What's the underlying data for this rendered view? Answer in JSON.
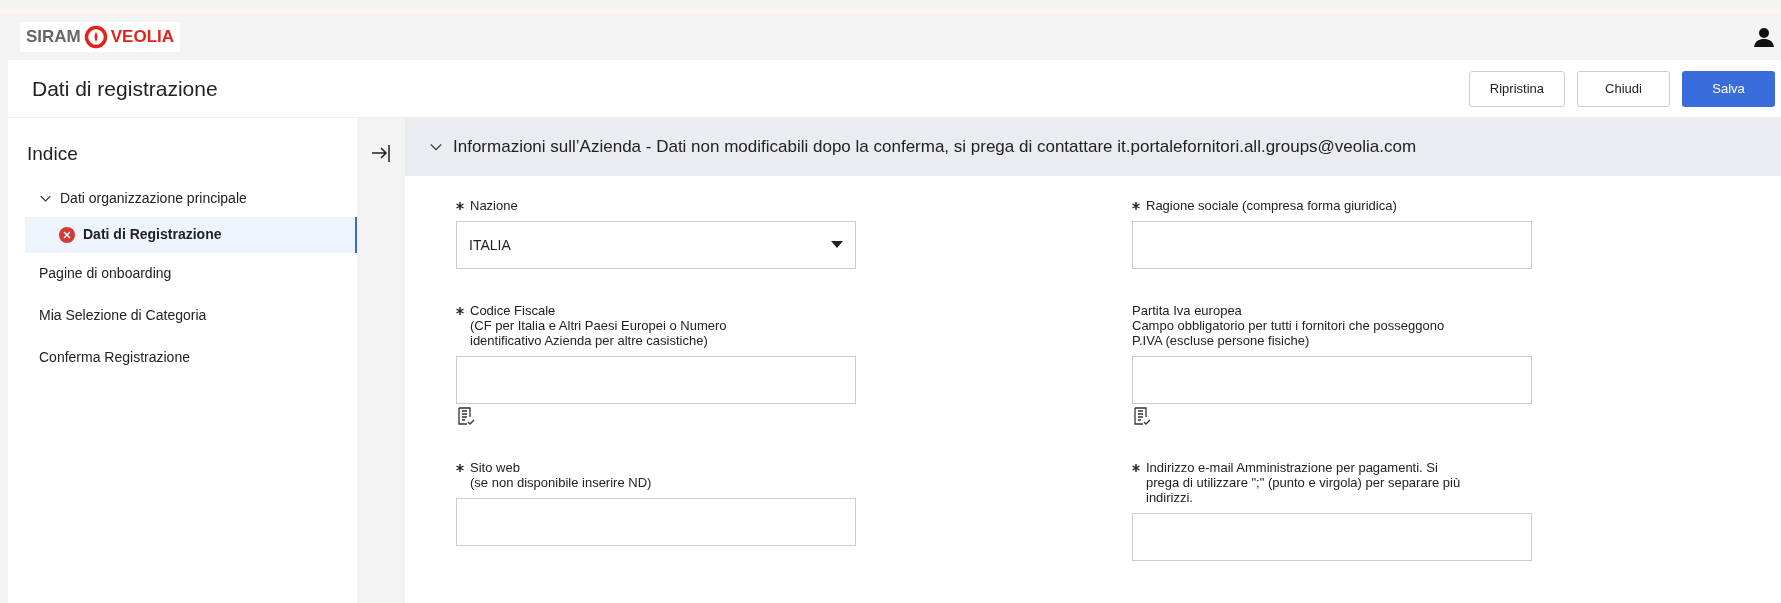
{
  "header": {
    "logo_left": "SIRAM",
    "logo_right": "VEOLIA"
  },
  "page": {
    "title": "Dati di registrazione"
  },
  "buttons": [
    {
      "label": "Ripristina",
      "kind": "secondary"
    },
    {
      "label": "Chiudi",
      "kind": "secondary"
    },
    {
      "label": "Salva",
      "kind": "primary"
    }
  ],
  "sidebar": {
    "title": "Indice",
    "items": [
      {
        "label": "Dati organizzazione principale",
        "expanded": true,
        "selected": false,
        "error": false,
        "children": [
          {
            "label": "Dati di Registrazione",
            "selected": true,
            "error": true
          }
        ]
      },
      {
        "label": "Pagine di onboarding",
        "selected": false,
        "error": false
      },
      {
        "label": "Mia Selezione di Categoria",
        "selected": false,
        "error": false
      },
      {
        "label": "Conferma Registrazione",
        "selected": false,
        "error": false
      }
    ]
  },
  "section": {
    "title": "Informazioni sull’Azienda - Dati non modificabili dopo la conferma, si prega di contattare it.portalefornitori.all.groups@veolia.com",
    "expanded": true
  },
  "fields": [
    {
      "kind": "select",
      "label": "Nazione",
      "required": true,
      "value": "ITALIA",
      "validate_icon": false
    },
    {
      "kind": "text",
      "label": "Ragione sociale (compresa forma giuridica)",
      "required": true,
      "validate_icon": false
    },
    {
      "kind": "text",
      "label": "Codice Fiscale",
      "hint": "(CF per Italia e Altri Paesi Europei o Numero\nidentificativo Azienda per altre casistiche)",
      "required": true,
      "validate_icon": true
    },
    {
      "kind": "text",
      "label": "Partita Iva europea",
      "hint": "Campo obbligatorio per tutti i fornitori che posseggono\nP.IVA (escluse persone fisiche)",
      "required": false,
      "validate_icon": true
    },
    {
      "kind": "text",
      "label": "Sito web",
      "hint": "(se non disponibile inserire ND)",
      "required": true,
      "validate_icon": false
    },
    {
      "kind": "text",
      "label": "Indirizzo e-mail Amministrazione per pagamenti. Si\nprega di utilizzare \";\" (punto e virgola) per separare più\nindirizzi.",
      "required": true,
      "validate_icon": false
    }
  ]
}
